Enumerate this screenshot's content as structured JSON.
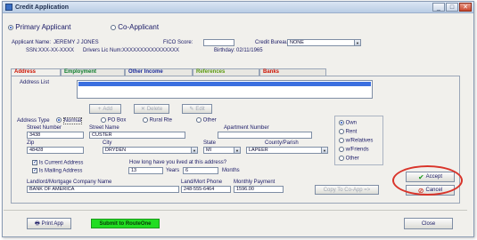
{
  "window": {
    "title": "Credit Application",
    "btn_min": "_",
    "btn_max": "□",
    "btn_close": "✕"
  },
  "applicant_type": {
    "primary": "Primary Applicant",
    "co": "Co-Applicant"
  },
  "header": {
    "name_label": "Applicant Name:",
    "name_value": "JEREMY J JONES",
    "fico_label": "FICO Score:",
    "fico_value": "",
    "bureau_label": "Credit Bureau:",
    "bureau_value": "NONE",
    "ssn_label": "SSN:",
    "ssn_value": "XXX-XX-XXXX",
    "dl_label": "Drivers Lic Num:",
    "dl_value": "XXXXXXXXXXXXXXXX",
    "bday_label": "Birthday:",
    "bday_value": "02/11/1965"
  },
  "tabs": [
    "Address",
    "Employment",
    "Other Income",
    "References",
    "Banks"
  ],
  "address": {
    "list_label": "Address List",
    "add": "Add",
    "delete": "Delete",
    "edit": "Edit",
    "type_label": "Address Type",
    "types": [
      "Normal",
      "PO Box",
      "Rural Rte",
      "Other"
    ],
    "street_number_label": "Street Number",
    "street_number": "3438",
    "street_name_label": "Street Name",
    "street_name": "CUSTER",
    "apt_label": "Apartment Number",
    "apt": "",
    "zip_label": "Zip",
    "zip": "48428",
    "city_label": "City",
    "city": "DRYDEN",
    "state_label": "State",
    "state": "MI",
    "county_label": "County/Parish",
    "county": "LAPEER",
    "is_current": "Is Current Address",
    "is_mailing": "Is Mailing Address",
    "how_long_label": "How long have you lived at this address?",
    "years": "13",
    "years_label": "Years",
    "months": "6",
    "months_label": "Months",
    "landlord_label": "Landlord/Mortgage Company Name",
    "landlord": "BANK OF AMERICA",
    "phone_label": "Land/Mort Phone",
    "phone": "248-555-6464",
    "payment_label": "Monthly Payment",
    "payment": "1596.00",
    "ownership": [
      "Own",
      "Rent",
      "w/Relatives",
      "w/Friends",
      "Other"
    ],
    "copy_to_coapp": "Copy To Co-App =>"
  },
  "actions": {
    "accept": "Accept",
    "cancel": "Cancel",
    "print": "Print App",
    "submit": "Submit to RouteOne",
    "close": "Close"
  },
  "colors": {
    "accept_ring": "#d9342a",
    "submit_bg": "#22dd22",
    "selection": "#3b6fe0"
  }
}
